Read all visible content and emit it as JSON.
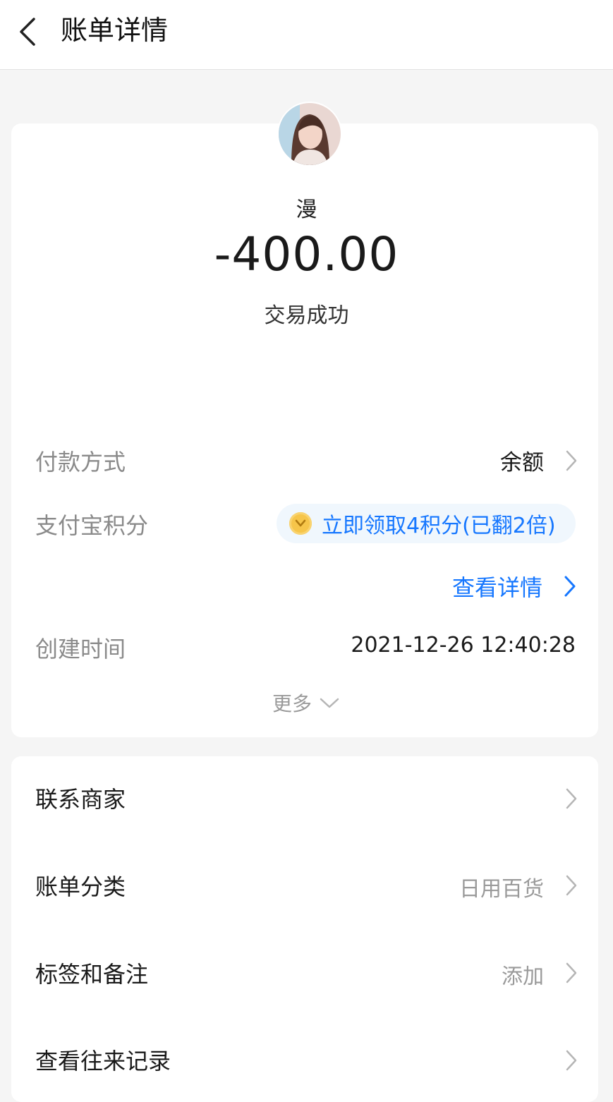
{
  "header": {
    "title": "账单详情"
  },
  "transaction": {
    "payee": "漫",
    "amount": "-400.00",
    "status": "交易成功"
  },
  "details": {
    "payment_method": {
      "label": "付款方式",
      "value": "余额"
    },
    "points": {
      "label": "支付宝积分",
      "value": "立即领取4积分(已翻2倍)"
    },
    "view_details": "查看详情",
    "created_time": {
      "label": "创建时间",
      "value": "2021-12-26 12:40:28"
    },
    "more": "更多"
  },
  "actions": [
    {
      "label": "联系商家",
      "value": ""
    },
    {
      "label": "账单分类",
      "value": "日用百货"
    },
    {
      "label": "标签和备注",
      "value": "添加"
    },
    {
      "label": "查看往来记录",
      "value": ""
    }
  ],
  "colors": {
    "accent": "#1677ff",
    "background": "#f5f5f5",
    "coin": "#f6c54a"
  },
  "icons": [
    "back-arrow-icon",
    "chevron-right-icon",
    "coin-icon",
    "chevron-down-icon"
  ]
}
